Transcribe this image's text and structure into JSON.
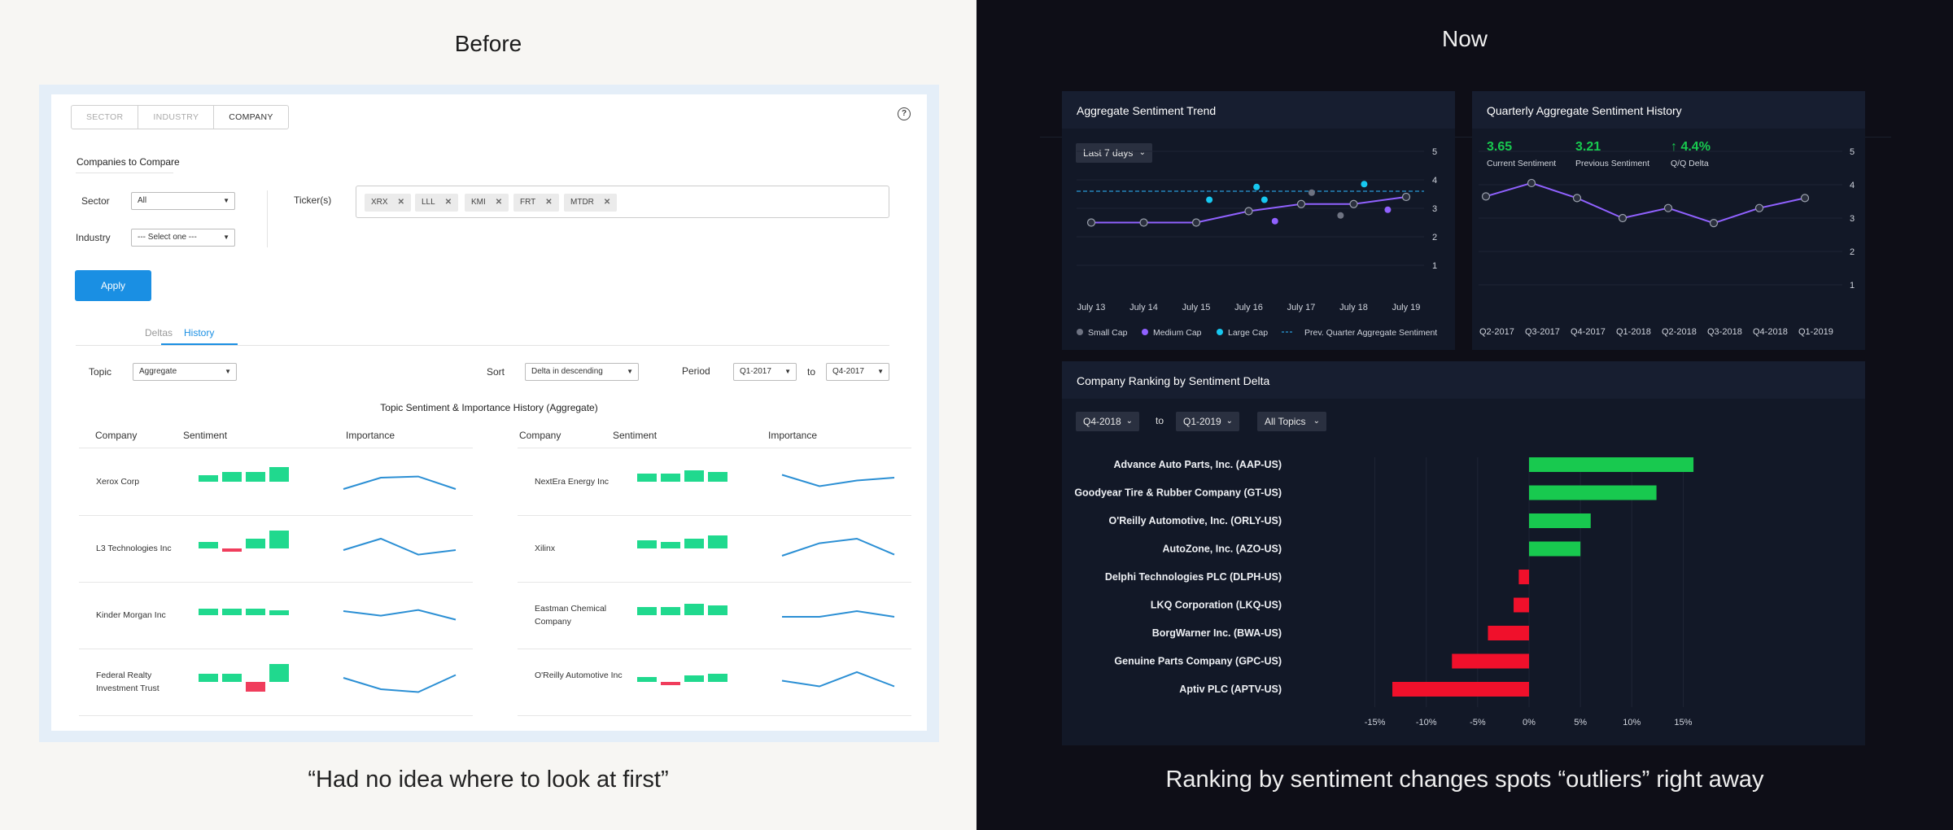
{
  "before": {
    "title": "Before",
    "caption": "“Had no idea where to look at first”",
    "tabs": [
      "SECTOR",
      "INDUSTRY",
      "COMPANY"
    ],
    "help_icon": "?",
    "compare_heading": "Companies to Compare",
    "sector_label": "Sector",
    "sector_value": "All",
    "industry_label": "Industry",
    "industry_value": "--- Select one ---",
    "tickers_label": "Ticker(s)",
    "tickers": [
      "XRX",
      "LLL",
      "KMI",
      "FRT",
      "MTDR"
    ],
    "apply_label": "Apply",
    "subtabs": [
      "Deltas",
      "History"
    ],
    "topic_label": "Topic",
    "topic_value": "Aggregate",
    "sort_label": "Sort",
    "sort_value": "Delta in descending",
    "period_label": "Period",
    "period_from": "Q1-2017",
    "period_to_label": "to",
    "period_to": "Q4-2017",
    "table_title": "Topic Sentiment & Importance History (Aggregate)",
    "col_company": "Company",
    "col_sentiment": "Sentiment",
    "col_importance": "Importance",
    "left_companies": [
      "Xerox Corp",
      "L3 Technologies Inc",
      "Kinder Morgan Inc",
      "Federal Realty Investment Trust"
    ],
    "right_companies": [
      "NextEra Energy Inc",
      "Xilinx",
      "Eastman Chemical Company",
      "O'Reilly Automotive Inc"
    ],
    "left_sentiment": [
      [
        2,
        3,
        3,
        4.5
      ],
      [
        2,
        -1,
        3,
        5.5
      ],
      [
        2,
        2,
        2,
        1.5
      ],
      [
        2.5,
        2.5,
        -3,
        5.5
      ]
    ],
    "right_sentiment": [
      [
        2.5,
        2.5,
        3.5,
        3
      ],
      [
        2.5,
        2,
        3,
        4
      ],
      [
        2.5,
        2.5,
        3.5,
        3
      ],
      [
        1.5,
        -1,
        2,
        2.5
      ]
    ],
    "left_importance": [
      [
        1,
        3,
        3.2,
        1
      ],
      [
        2,
        4,
        1.2,
        2
      ],
      [
        3,
        2.2,
        3.2,
        1.5
      ],
      [
        3,
        1,
        0.5,
        3.5
      ]
    ],
    "right_importance": [
      [
        3.5,
        1.5,
        2.5,
        3
      ],
      [
        1,
        3.2,
        4,
        1.2
      ],
      [
        2,
        2,
        3,
        2
      ],
      [
        2.5,
        1.5,
        4,
        1.5
      ]
    ],
    "colors": {
      "positive": "#20d98e",
      "negative": "#f03d5c",
      "line": "#2b8fd4",
      "primary": "#1a8fe3"
    }
  },
  "now": {
    "title": "Now",
    "caption": "Ranking by sentiment changes spots “outliers” right away",
    "trend_panel": {
      "title": "Aggregate Sentiment Trend",
      "range_dropdown": "Last 7 days",
      "legend": [
        "Small Cap",
        "Medium Cap",
        "Large Cap",
        "Prev. Quarter Aggregate Sentiment"
      ]
    },
    "history_panel": {
      "title": "Quarterly Aggregate Sentiment History",
      "current_value": "3.65",
      "current_label": "Current Sentiment",
      "previous_value": "3.21",
      "previous_label": "Previous Sentiment",
      "delta_value": "4.4%",
      "delta_label": "Q/Q Delta",
      "delta_arrow": "↑"
    },
    "ranking_panel": {
      "title": "Company Ranking by Sentiment Delta",
      "from": "Q4-2018",
      "to_label": "to",
      "to": "Q1-2019",
      "topics": "All Topics"
    },
    "colors": {
      "positive": "#18c94f",
      "negative": "#f0102b",
      "purple": "#9061ff",
      "cyan": "#17c8f0",
      "grey": "#6e7382"
    }
  },
  "chart_data": [
    {
      "type": "line",
      "title": "Aggregate Sentiment Trend",
      "categories": [
        "July 13",
        "July 14",
        "July 15",
        "July 16",
        "July 17",
        "July 18",
        "July 19"
      ],
      "ylim": [
        1,
        5
      ],
      "yticks": [
        1,
        2,
        3,
        4,
        5
      ],
      "series": [
        {
          "name": "Aggregate",
          "values": [
            2.5,
            2.5,
            2.5,
            2.9,
            3.15,
            3.15,
            3.4
          ]
        },
        {
          "name": "Small Cap",
          "x": [
            4.2,
            4.75
          ],
          "values": [
            3.55,
            2.75
          ]
        },
        {
          "name": "Medium Cap",
          "x": [
            3.5,
            5.65
          ],
          "values": [
            2.55,
            2.95
          ]
        },
        {
          "name": "Large Cap",
          "x": [
            2.25,
            3.15,
            3.3,
            5.2
          ],
          "values": [
            3.3,
            3.75,
            3.3,
            3.85
          ]
        },
        {
          "name": "Prev. Quarter Aggregate Sentiment",
          "values": [
            3.6,
            3.6,
            3.6,
            3.6,
            3.6,
            3.6,
            3.6
          ]
        }
      ],
      "legend": "bottom"
    },
    {
      "type": "line",
      "title": "Quarterly Aggregate Sentiment History",
      "categories": [
        "Q2-2017",
        "Q3-2017",
        "Q4-2017",
        "Q1-2018",
        "Q2-2018",
        "Q3-2018",
        "Q4-2018",
        "Q1-2019"
      ],
      "ylim": [
        1,
        5
      ],
      "yticks": [
        1,
        2,
        3,
        4,
        5
      ],
      "series": [
        {
          "name": "Aggregate Sentiment",
          "values": [
            3.65,
            4.05,
            3.6,
            3.0,
            3.3,
            2.85,
            3.3,
            3.6
          ]
        }
      ]
    },
    {
      "type": "bar",
      "orientation": "horizontal",
      "title": "Company Ranking by Sentiment Delta",
      "categories": [
        "Advance Auto Parts, Inc. (AAP-US)",
        "Goodyear Tire & Rubber Company (GT-US)",
        "O'Reilly Automotive, Inc. (ORLY-US)",
        "AutoZone, Inc. (AZO-US)",
        "Delphi Technologies PLC (DLPH-US)",
        "LKQ Corporation (LKQ-US)",
        "BorgWarner Inc. (BWA-US)",
        "Genuine Parts Company (GPC-US)",
        "Aptiv PLC (APTV-US)"
      ],
      "values": [
        16,
        12.4,
        6,
        5,
        -1,
        -1.5,
        -4,
        -7.5,
        -13.3
      ],
      "xlim": [
        -15,
        15
      ],
      "xticks": [
        -15,
        -10,
        -5,
        0,
        5,
        10,
        15
      ],
      "xtick_labels": [
        "-15%",
        "-10%",
        "-5%",
        "0%",
        "5%",
        "10%",
        "15%"
      ]
    }
  ]
}
